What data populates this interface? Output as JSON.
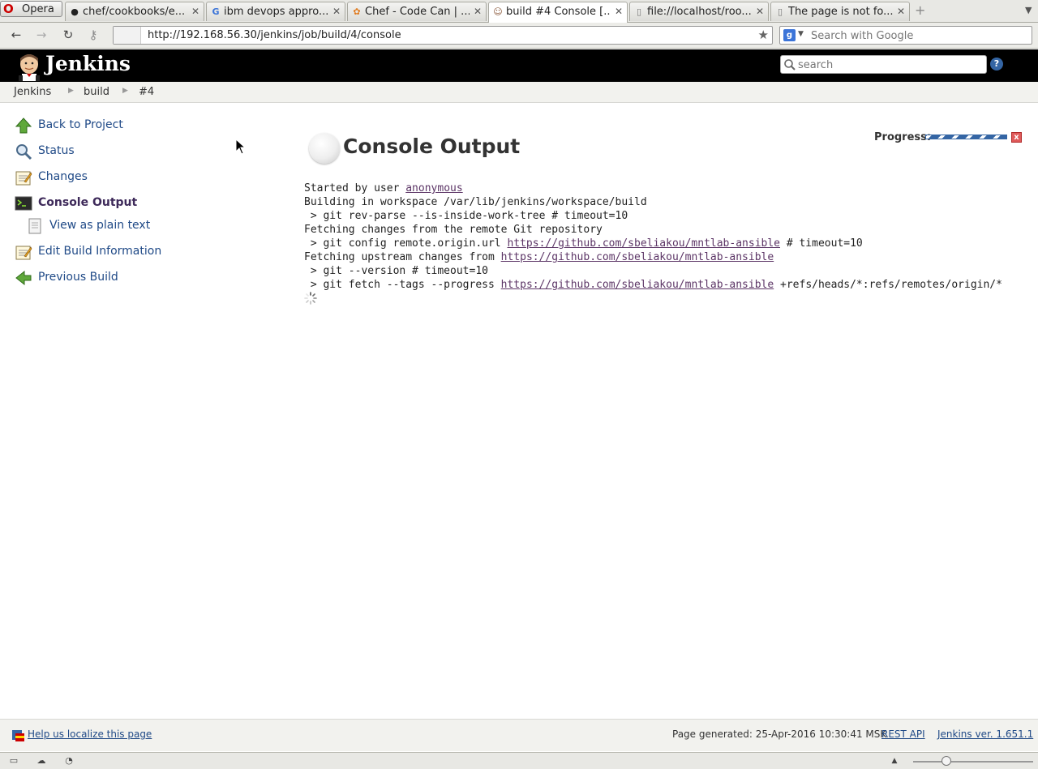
{
  "browser": {
    "menu_label": "Opera",
    "tabs": [
      {
        "title": "chef/cookbooks/e...",
        "icon": "github-icon"
      },
      {
        "title": "ibm devops appro...",
        "icon": "google-icon"
      },
      {
        "title": "Chef - Code Can | ...",
        "icon": "chef-icon"
      },
      {
        "title": "build #4 Console [...",
        "icon": "jenkins-icon"
      },
      {
        "title": "file://localhost/roo...",
        "icon": "page-icon"
      },
      {
        "title": "The page is not fo...",
        "icon": "page-icon"
      }
    ],
    "active_tab": 3,
    "url": "http://192.168.56.30/jenkins/job/build/4/console",
    "search_placeholder": "Search with Google"
  },
  "jenkins": {
    "title": "Jenkins",
    "search_placeholder": "search",
    "help_label": "?"
  },
  "breadcrumbs": [
    "Jenkins",
    "build",
    "#4"
  ],
  "sidebar": {
    "items": [
      {
        "label": "Back to Project",
        "icon": "up-arrow-icon"
      },
      {
        "label": "Status",
        "icon": "magnifier-icon"
      },
      {
        "label": "Changes",
        "icon": "notepad-icon"
      },
      {
        "label": "Console Output",
        "icon": "terminal-icon"
      },
      {
        "label": "View as plain text",
        "icon": "document-icon"
      },
      {
        "label": "Edit Build Information",
        "icon": "notepad-icon"
      },
      {
        "label": "Previous Build",
        "icon": "left-arrow-icon"
      }
    ]
  },
  "main": {
    "title": "Console Output",
    "progress_label": "Progress:",
    "progress_stop_label": "x",
    "console": {
      "l1_prefix": "Started by user ",
      "l1_user": "anonymous",
      "l2": "Building in workspace /var/lib/jenkins/workspace/build",
      "l3": " > git rev-parse --is-inside-work-tree # timeout=10",
      "l4": "Fetching changes from the remote Git repository",
      "l5_prefix": " > git config remote.origin.url ",
      "l5_link": "https://github.com/sbeliakou/mntlab-ansible",
      "l5_suffix": " # timeout=10",
      "l6_prefix": "Fetching upstream changes from ",
      "l6_link": "https://github.com/sbeliakou/mntlab-ansible",
      "l7": " > git --version # timeout=10",
      "l8_prefix": " > git fetch --tags --progress ",
      "l8_link": "https://github.com/sbeliakou/mntlab-ansible",
      "l8_suffix": " +refs/heads/*:refs/remotes/origin/*"
    }
  },
  "footer": {
    "localize": "Help us localize this page",
    "generated": "Page generated: 25-Apr-2016 10:30:41 MSK",
    "rest_api": "REST API",
    "version": "Jenkins ver. 1.651.1"
  }
}
